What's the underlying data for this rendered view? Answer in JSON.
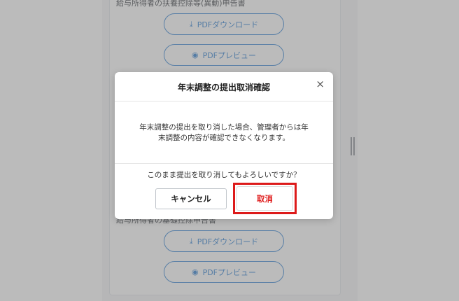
{
  "background": {
    "section_top_label": "給与所得者の扶養控除等(異動)申告書",
    "section_bottom_label": "給与所得者の基礎控除申告書",
    "pdf_download_label": "PDFダウンロード",
    "pdf_preview_label": "PDFプレビュー",
    "download_icon": "download-icon",
    "preview_icon": "eye-icon"
  },
  "modal": {
    "title": "年末調整の提出取消確認",
    "close_icon": "×",
    "body_line1": "年末調整の提出を取り消した場合、管理者からは年",
    "body_line2": "末調整の内容が確認できなくなります。",
    "question": "このまま提出を取り消してもよろしいですか？",
    "cancel_label": "キャンセル",
    "confirm_label": "取消"
  },
  "colors": {
    "overlay": "#787878",
    "accent_blue": "#2f7fd0",
    "danger_red": "#e02020",
    "highlight_red": "#dd1a1a"
  }
}
